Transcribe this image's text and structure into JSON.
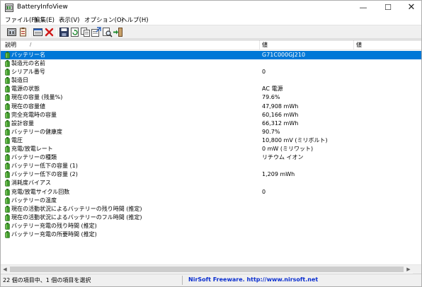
{
  "window": {
    "title": "BatteryInfoView",
    "minimize": "—",
    "maximize": "☐",
    "close": "✕"
  },
  "menu": [
    {
      "label": "ファイル(F)"
    },
    {
      "label": "編集(E)"
    },
    {
      "label": "表示(V)"
    },
    {
      "label": "オプション(O)"
    },
    {
      "label": "ヘルプ(H)"
    }
  ],
  "toolbar": {
    "icons": [
      "battery-info-icon",
      "battery-log-icon",
      "properties-icon",
      "delete-icon",
      "save-icon",
      "refresh-icon",
      "copy-icon",
      "html-report-icon",
      "find-icon",
      "exit-icon"
    ]
  },
  "columns": {
    "name": "説明",
    "sort_indicator": "/",
    "value": "値",
    "extra": "値"
  },
  "rows": [
    {
      "name": "バッテリー名",
      "value": "G71C000GJ210"
    },
    {
      "name": "製造元の名前",
      "value": ""
    },
    {
      "name": "シリアル番号",
      "value": "0"
    },
    {
      "name": "製造日",
      "value": ""
    },
    {
      "name": "電源の状態",
      "value": "AC 電源"
    },
    {
      "name": "現在の容量 (残量%)",
      "value": "79.6%"
    },
    {
      "name": "現在の容量値",
      "value": "47,908 mWh"
    },
    {
      "name": "完全充電時の容量",
      "value": "60,166 mWh"
    },
    {
      "name": "設計容量",
      "value": "66,312 mWh"
    },
    {
      "name": "バッテリーの健康度",
      "value": "90.7%"
    },
    {
      "name": "電圧",
      "value": "10,800 mV (ミリボルト)"
    },
    {
      "name": "充電/放電レート",
      "value": "0 mW (ミリワット)"
    },
    {
      "name": "バッテリーの種類",
      "value": "リチウム イオン"
    },
    {
      "name": "バッテリー低下の容量 (1)",
      "value": ""
    },
    {
      "name": "バッテリー低下の容量 (2)",
      "value": "1,209 mWh"
    },
    {
      "name": "消耗度バイアス",
      "value": ""
    },
    {
      "name": "充電/放電サイクル回数",
      "value": "0"
    },
    {
      "name": "バッテリーの温度",
      "value": ""
    },
    {
      "name": "現在の活動状況によるバッテリーの残り時間 (推定)",
      "value": ""
    },
    {
      "name": "現在の活動状況によるバッテリーのフル時間 (推定)",
      "value": ""
    },
    {
      "name": "バッテリー充電の残り時間 (推定)",
      "value": ""
    },
    {
      "name": "バッテリー充電の所要時間 (推定)",
      "value": ""
    }
  ],
  "selected_row": 0,
  "status": {
    "count_text": "22 個の項目中、1 個の項目を選択",
    "link_text": "NirSoft Freeware.  http://www.nirsoft.net"
  },
  "colors": {
    "selection": "#0078d7",
    "link": "#0a2ecf",
    "battery_green": "#3f9b2a"
  }
}
